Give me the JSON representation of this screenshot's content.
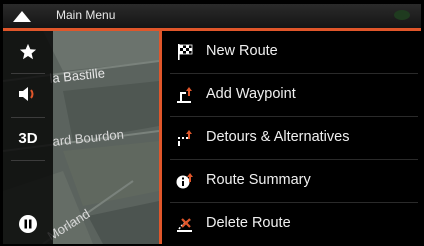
{
  "header": {
    "title": "Main Menu"
  },
  "map": {
    "streets": [
      "la Bastille",
      "ard Bourdon",
      "Morland"
    ]
  },
  "sidebar": {
    "items": [
      {
        "icon": "star-icon"
      },
      {
        "icon": "speaker-icon"
      },
      {
        "icon": "view-mode",
        "label": "3D"
      },
      {
        "icon": "pause-icon"
      }
    ]
  },
  "menu": {
    "items": [
      {
        "icon": "checkered-flag-icon",
        "label": "New Route"
      },
      {
        "icon": "add-waypoint-icon",
        "label": "Add Waypoint"
      },
      {
        "icon": "detours-icon",
        "label": "Detours & Alternatives"
      },
      {
        "icon": "route-summary-icon",
        "label": "Route Summary"
      },
      {
        "icon": "delete-route-icon",
        "label": "Delete Route"
      }
    ]
  },
  "colors": {
    "accent": "#e0562a",
    "background": "#000000"
  }
}
